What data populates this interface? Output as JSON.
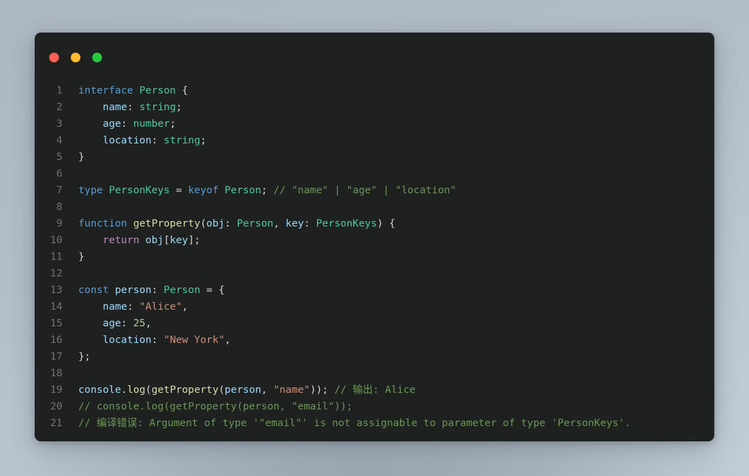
{
  "window": {
    "background_color": "#1f2020",
    "traffic_lights": [
      {
        "name": "close",
        "color": "#ff5f57"
      },
      {
        "name": "minimize",
        "color": "#febc2e"
      },
      {
        "name": "maximize",
        "color": "#28c840"
      }
    ]
  },
  "editor": {
    "language": "typescript",
    "line_number_color": "#6f7478",
    "lines": [
      {
        "number": "1",
        "text": "interface Person {"
      },
      {
        "number": "2",
        "text": "    name: string;"
      },
      {
        "number": "3",
        "text": "    age: number;"
      },
      {
        "number": "4",
        "text": "    location: string;"
      },
      {
        "number": "5",
        "text": "}"
      },
      {
        "number": "6",
        "text": ""
      },
      {
        "number": "7",
        "text": "type PersonKeys = keyof Person; // \"name\" | \"age\" | \"location\""
      },
      {
        "number": "8",
        "text": ""
      },
      {
        "number": "9",
        "text": "function getProperty(obj: Person, key: PersonKeys) {"
      },
      {
        "number": "10",
        "text": "    return obj[key];"
      },
      {
        "number": "11",
        "text": "}"
      },
      {
        "number": "12",
        "text": ""
      },
      {
        "number": "13",
        "text": "const person: Person = {"
      },
      {
        "number": "14",
        "text": "    name: \"Alice\","
      },
      {
        "number": "15",
        "text": "    age: 25,"
      },
      {
        "number": "16",
        "text": "    location: \"New York\","
      },
      {
        "number": "17",
        "text": "};"
      },
      {
        "number": "18",
        "text": ""
      },
      {
        "number": "19",
        "text": "console.log(getProperty(person, \"name\")); // 输出: Alice"
      },
      {
        "number": "20",
        "text": "// console.log(getProperty(person, \"email\"));"
      },
      {
        "number": "21",
        "text": "// 编译错误: Argument of type '\"email\"' is not assignable to parameter of type 'PersonKeys'."
      }
    ],
    "tokens": {
      "l1": [
        {
          "t": "interface",
          "c": "t-kw"
        },
        {
          "t": " ",
          "c": "t-plain"
        },
        {
          "t": "Person",
          "c": "t-type"
        },
        {
          "t": " {",
          "c": "t-plain"
        }
      ],
      "l2": [
        {
          "t": "    ",
          "c": "t-plain"
        },
        {
          "t": "name",
          "c": "t-prop"
        },
        {
          "t": ": ",
          "c": "t-plain"
        },
        {
          "t": "string",
          "c": "t-type"
        },
        {
          "t": ";",
          "c": "t-plain"
        }
      ],
      "l3": [
        {
          "t": "    ",
          "c": "t-plain"
        },
        {
          "t": "age",
          "c": "t-prop"
        },
        {
          "t": ": ",
          "c": "t-plain"
        },
        {
          "t": "number",
          "c": "t-type"
        },
        {
          "t": ";",
          "c": "t-plain"
        }
      ],
      "l4": [
        {
          "t": "    ",
          "c": "t-plain"
        },
        {
          "t": "location",
          "c": "t-prop"
        },
        {
          "t": ": ",
          "c": "t-plain"
        },
        {
          "t": "string",
          "c": "t-type"
        },
        {
          "t": ";",
          "c": "t-plain"
        }
      ],
      "l5": [
        {
          "t": "}",
          "c": "t-plain"
        }
      ],
      "l6": [],
      "l7": [
        {
          "t": "type",
          "c": "t-kw"
        },
        {
          "t": " ",
          "c": "t-plain"
        },
        {
          "t": "PersonKeys",
          "c": "t-type"
        },
        {
          "t": " = ",
          "c": "t-plain"
        },
        {
          "t": "keyof",
          "c": "t-kw"
        },
        {
          "t": " ",
          "c": "t-plain"
        },
        {
          "t": "Person",
          "c": "t-type"
        },
        {
          "t": "; ",
          "c": "t-plain"
        },
        {
          "t": "// \"name\" | \"age\" | \"location\"",
          "c": "t-cmt"
        }
      ],
      "l8": [],
      "l9": [
        {
          "t": "function",
          "c": "t-kw"
        },
        {
          "t": " ",
          "c": "t-plain"
        },
        {
          "t": "getProperty",
          "c": "t-fn"
        },
        {
          "t": "(",
          "c": "t-plain"
        },
        {
          "t": "obj",
          "c": "t-prop"
        },
        {
          "t": ": ",
          "c": "t-plain"
        },
        {
          "t": "Person",
          "c": "t-type"
        },
        {
          "t": ", ",
          "c": "t-plain"
        },
        {
          "t": "key",
          "c": "t-prop"
        },
        {
          "t": ": ",
          "c": "t-plain"
        },
        {
          "t": "PersonKeys",
          "c": "t-type"
        },
        {
          "t": ") {",
          "c": "t-plain"
        }
      ],
      "l10": [
        {
          "t": "    ",
          "c": "t-plain"
        },
        {
          "t": "return",
          "c": "t-ctrl"
        },
        {
          "t": " ",
          "c": "t-plain"
        },
        {
          "t": "obj",
          "c": "t-prop"
        },
        {
          "t": "[",
          "c": "t-plain"
        },
        {
          "t": "key",
          "c": "t-prop"
        },
        {
          "t": "];",
          "c": "t-plain"
        }
      ],
      "l11": [
        {
          "t": "}",
          "c": "t-plain"
        }
      ],
      "l12": [],
      "l13": [
        {
          "t": "const",
          "c": "t-kw"
        },
        {
          "t": " ",
          "c": "t-plain"
        },
        {
          "t": "person",
          "c": "t-prop"
        },
        {
          "t": ": ",
          "c": "t-plain"
        },
        {
          "t": "Person",
          "c": "t-type"
        },
        {
          "t": " = {",
          "c": "t-plain"
        }
      ],
      "l14": [
        {
          "t": "    ",
          "c": "t-plain"
        },
        {
          "t": "name",
          "c": "t-prop"
        },
        {
          "t": ": ",
          "c": "t-plain"
        },
        {
          "t": "\"Alice\"",
          "c": "t-str"
        },
        {
          "t": ",",
          "c": "t-plain"
        }
      ],
      "l15": [
        {
          "t": "    ",
          "c": "t-plain"
        },
        {
          "t": "age",
          "c": "t-prop"
        },
        {
          "t": ": ",
          "c": "t-plain"
        },
        {
          "t": "25",
          "c": "t-num"
        },
        {
          "t": ",",
          "c": "t-plain"
        }
      ],
      "l16": [
        {
          "t": "    ",
          "c": "t-plain"
        },
        {
          "t": "location",
          "c": "t-prop"
        },
        {
          "t": ": ",
          "c": "t-plain"
        },
        {
          "t": "\"New York\"",
          "c": "t-str"
        },
        {
          "t": ",",
          "c": "t-plain"
        }
      ],
      "l17": [
        {
          "t": "};",
          "c": "t-plain"
        }
      ],
      "l18": [],
      "l19": [
        {
          "t": "console",
          "c": "t-prop"
        },
        {
          "t": ".",
          "c": "t-plain"
        },
        {
          "t": "log",
          "c": "t-fn"
        },
        {
          "t": "(",
          "c": "t-plain"
        },
        {
          "t": "getProperty",
          "c": "t-fn"
        },
        {
          "t": "(",
          "c": "t-plain"
        },
        {
          "t": "person",
          "c": "t-prop"
        },
        {
          "t": ", ",
          "c": "t-plain"
        },
        {
          "t": "\"name\"",
          "c": "t-str"
        },
        {
          "t": ")); ",
          "c": "t-plain"
        },
        {
          "t": "// 输出: Alice",
          "c": "t-cmt"
        }
      ],
      "l20": [
        {
          "t": "// console.log(getProperty(person, \"email\"));",
          "c": "t-cmt"
        }
      ],
      "l21": [
        {
          "t": "// 编译错误: Argument of type '\"email\"' is not assignable to parameter of type 'PersonKeys'.",
          "c": "t-cmt"
        }
      ]
    }
  }
}
